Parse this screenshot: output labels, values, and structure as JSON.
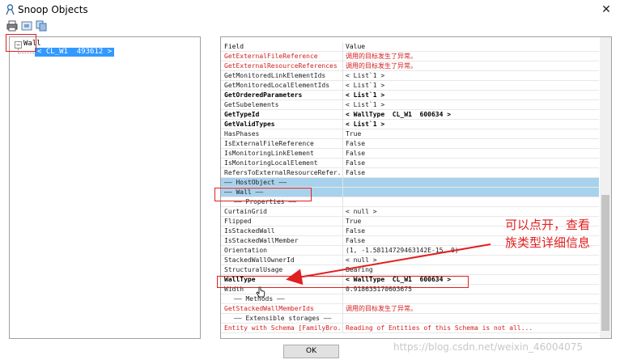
{
  "window": {
    "title": "Snoop Objects",
    "close_label": "✕"
  },
  "toolbar": {
    "icons": [
      "print-icon",
      "print-preview-icon",
      "copy-icon"
    ]
  },
  "tree": {
    "root_label": "Wall",
    "expander": "−",
    "child_label": "< CL_W1  493612 >"
  },
  "grid": {
    "header": {
      "field": "Field",
      "value": "Value"
    },
    "rows": [
      {
        "field": "GetExternalFileReference",
        "value": "调用的目标发生了异常。",
        "style": "err"
      },
      {
        "field": "GetExternalResourceReferences",
        "value": "调用的目标发生了异常。",
        "style": "err"
      },
      {
        "field": "GetMonitoredLinkElementIds",
        "value": "< List`1 >",
        "style": ""
      },
      {
        "field": "GetMonitoredLocalElementIds",
        "value": "< List`1 >",
        "style": ""
      },
      {
        "field": "GetOrderedParameters",
        "value": "< List`1 >",
        "style": "bold"
      },
      {
        "field": "GetSubelements",
        "value": "< List`1 >",
        "style": ""
      },
      {
        "field": "GetTypeId",
        "value": "< WallType  CL_W1  600634 >",
        "style": "bold"
      },
      {
        "field": "GetValidTypes",
        "value": "< List`1 >",
        "style": "bold"
      },
      {
        "field": "HasPhases",
        "value": "True",
        "style": ""
      },
      {
        "field": "IsExternalFileReference",
        "value": "False",
        "style": ""
      },
      {
        "field": "IsMonitoringLinkElement",
        "value": "False",
        "style": ""
      },
      {
        "field": "IsMonitoringLocalElement",
        "value": "False",
        "style": ""
      },
      {
        "field": "RefersToExternalResourceRefer...",
        "value": "False",
        "style": ""
      },
      {
        "field": "—— HostObject ——",
        "value": "",
        "style": "selected"
      },
      {
        "field": "—— Wall ——",
        "value": "",
        "style": "selected"
      },
      {
        "field": "—— Properties ——",
        "value": "",
        "style": "group"
      },
      {
        "field": "CurtainGrid",
        "value": "< null >",
        "style": ""
      },
      {
        "field": "Flipped",
        "value": "True",
        "style": ""
      },
      {
        "field": "IsStackedWall",
        "value": "False",
        "style": ""
      },
      {
        "field": "IsStackedWallMember",
        "value": "False",
        "style": ""
      },
      {
        "field": "Orientation",
        "value": "(1, -1.58114729463142E-15, 0)",
        "style": ""
      },
      {
        "field": "StackedWallOwnerId",
        "value": "< null >",
        "style": ""
      },
      {
        "field": "StructuralUsage",
        "value": "Bearing",
        "style": ""
      },
      {
        "field": "WallType",
        "value": "< WallType  CL_W1  600634 >",
        "style": "bold"
      },
      {
        "field": "Width",
        "value": "0.918635170603675",
        "style": ""
      },
      {
        "field": "—— Methods ——",
        "value": "",
        "style": "group"
      },
      {
        "field": "GetStackedWallMemberIds",
        "value": "调用的目标发生了异常。",
        "style": "err"
      },
      {
        "field": "—— Extensible storages ——",
        "value": "",
        "style": "group"
      },
      {
        "field": "Entity with Schema [FamilyBro...",
        "value": "Reading of Entities of this Schema is not all...",
        "style": "err"
      }
    ]
  },
  "buttons": {
    "ok_label": "OK"
  },
  "annotation": {
    "text": "可以点开，查看\n族类型详细信息",
    "color": "#e02020"
  },
  "watermark": "https://blog.csdn.net/weixin_46004075",
  "colors": {
    "selection": "#3399ff",
    "selected_row": "#a8d2ec",
    "error_text": "#d31e1e",
    "annotation": "#e02020"
  }
}
